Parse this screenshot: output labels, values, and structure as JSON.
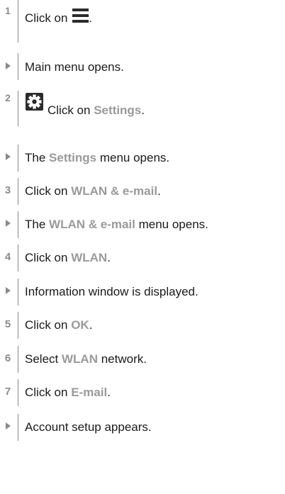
{
  "steps": [
    {
      "kind": "step",
      "marker": "1",
      "parts": {
        "a": "Click on",
        "b": "."
      },
      "icon": "hamburger-menu-icon"
    },
    {
      "kind": "result",
      "parts": {
        "a": "Main menu opens."
      }
    },
    {
      "kind": "step",
      "marker": "2",
      "parts": {
        "a": "Click on",
        "hl": "Settings",
        "b": "."
      },
      "icon": "gear-icon"
    },
    {
      "kind": "result",
      "parts": {
        "a": "The",
        "hl": "Settings",
        "b": "menu opens."
      }
    },
    {
      "kind": "step",
      "marker": "3",
      "parts": {
        "a": "Click on",
        "hl": "WLAN & e-mail",
        "b": "."
      }
    },
    {
      "kind": "result",
      "parts": {
        "a": "The",
        "hl": "WLAN & e-mail",
        "b": "menu opens."
      }
    },
    {
      "kind": "step",
      "marker": "4",
      "parts": {
        "a": "Click on",
        "hl": "WLAN",
        "b": "."
      }
    },
    {
      "kind": "result",
      "parts": {
        "a": "Information window is displayed."
      }
    },
    {
      "kind": "step",
      "marker": "5",
      "parts": {
        "a": "Click on",
        "hl": "OK",
        "b": "."
      }
    },
    {
      "kind": "step",
      "marker": "6",
      "parts": {
        "a": "Select",
        "hl": "WLAN",
        "b": "network."
      }
    },
    {
      "kind": "step",
      "marker": "7",
      "parts": {
        "a": "Click on",
        "hl": "E-mail",
        "b": "."
      }
    },
    {
      "kind": "result",
      "parts": {
        "a": "Account setup appears."
      }
    }
  ],
  "colors": {
    "text": "#1a1a1a",
    "highlight": "#9a9a9a",
    "marker": "#8c8c8c",
    "rule": "#8a8a8a"
  }
}
